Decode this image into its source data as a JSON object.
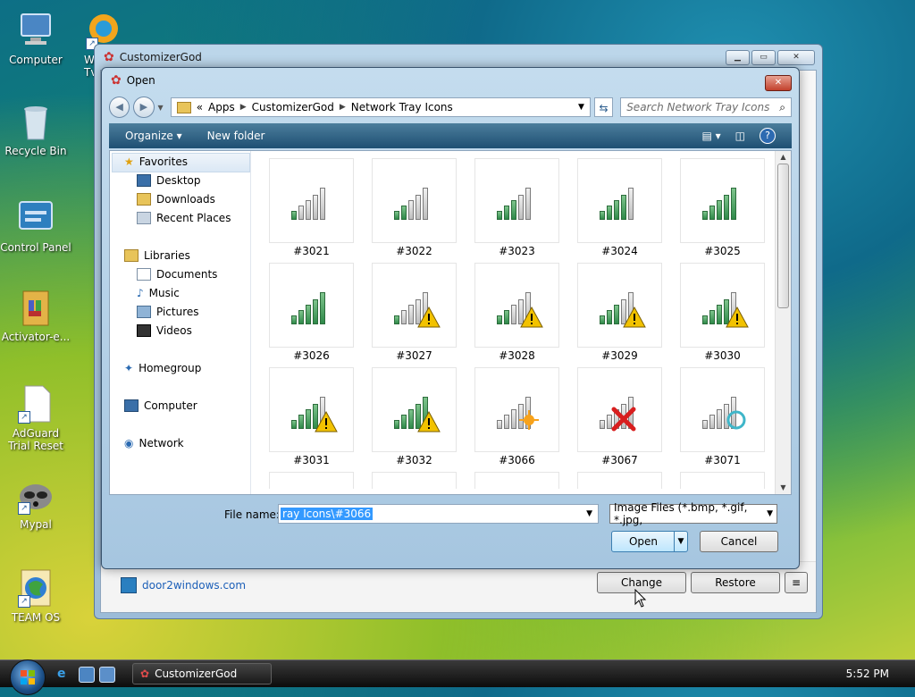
{
  "desktop": {
    "icons": [
      {
        "label": "Computer",
        "shortcut": false
      },
      {
        "label": "Recycle Bin",
        "shortcut": false
      },
      {
        "label": "Control Panel",
        "shortcut": false
      },
      {
        "label": "Activator-e...",
        "shortcut": false
      },
      {
        "label": "AdGuard Trial Reset",
        "shortcut": true
      },
      {
        "label": "Mypal",
        "shortcut": true
      },
      {
        "label": "TEAM OS",
        "shortcut": true
      },
      {
        "label": "W",
        "label2": "Tv",
        "shortcut": true
      }
    ]
  },
  "app": {
    "title": "CustomizerGod",
    "footer_link": "door2windows.com",
    "change_label": "Change",
    "restore_label": "Restore",
    "menu_glyph": "≡"
  },
  "dialog": {
    "title": "Open",
    "close_glyph": "✕",
    "breadcrumb": {
      "prefix": "«",
      "items": [
        "Apps",
        "CustomizerGod",
        "Network Tray Icons"
      ]
    },
    "search_placeholder": "Search Network Tray Icons",
    "toolbar": {
      "organize": "Organize ▾",
      "new_folder": "New folder",
      "help": "?"
    },
    "nav": {
      "favorites": "Favorites",
      "desktop": "Desktop",
      "downloads": "Downloads",
      "recent": "Recent Places",
      "libraries": "Libraries",
      "documents": "Documents",
      "music": "Music",
      "pictures": "Pictures",
      "videos": "Videos",
      "homegroup": "Homegroup",
      "computer": "Computer",
      "network": "Network"
    },
    "files": [
      {
        "name": "#3021",
        "bars": 1,
        "badge": "none"
      },
      {
        "name": "#3022",
        "bars": 2,
        "badge": "none"
      },
      {
        "name": "#3023",
        "bars": 3,
        "badge": "none"
      },
      {
        "name": "#3024",
        "bars": 4,
        "badge": "none"
      },
      {
        "name": "#3025",
        "bars": 5,
        "badge": "none"
      },
      {
        "name": "#3026",
        "bars": 5,
        "badge": "none"
      },
      {
        "name": "#3027",
        "bars": 1,
        "badge": "warning"
      },
      {
        "name": "#3028",
        "bars": 2,
        "badge": "warning"
      },
      {
        "name": "#3029",
        "bars": 3,
        "badge": "warning"
      },
      {
        "name": "#3030",
        "bars": 4,
        "badge": "warning"
      },
      {
        "name": "#3031",
        "bars": 4,
        "badge": "warning"
      },
      {
        "name": "#3032",
        "bars": 5,
        "badge": "warning"
      },
      {
        "name": "#3066",
        "bars": 0,
        "badge": "star"
      },
      {
        "name": "#3067",
        "bars": 0,
        "badge": "error"
      },
      {
        "name": "#3071",
        "bars": 0,
        "badge": "busy"
      }
    ],
    "file_name_label": "File name:",
    "file_name_value": "ray Icons\\#3066",
    "filter_value": "Image Files (*.bmp, *.gif, *.jpg,",
    "open_label": "Open",
    "cancel_label": "Cancel"
  },
  "taskbar": {
    "app_label": "CustomizerGod",
    "clock": "5:52 PM"
  },
  "colors": {
    "signal_on": "#2f8a4a",
    "warning": "#f2c200",
    "error": "#d81e1e",
    "accent": "#1e4f73"
  }
}
